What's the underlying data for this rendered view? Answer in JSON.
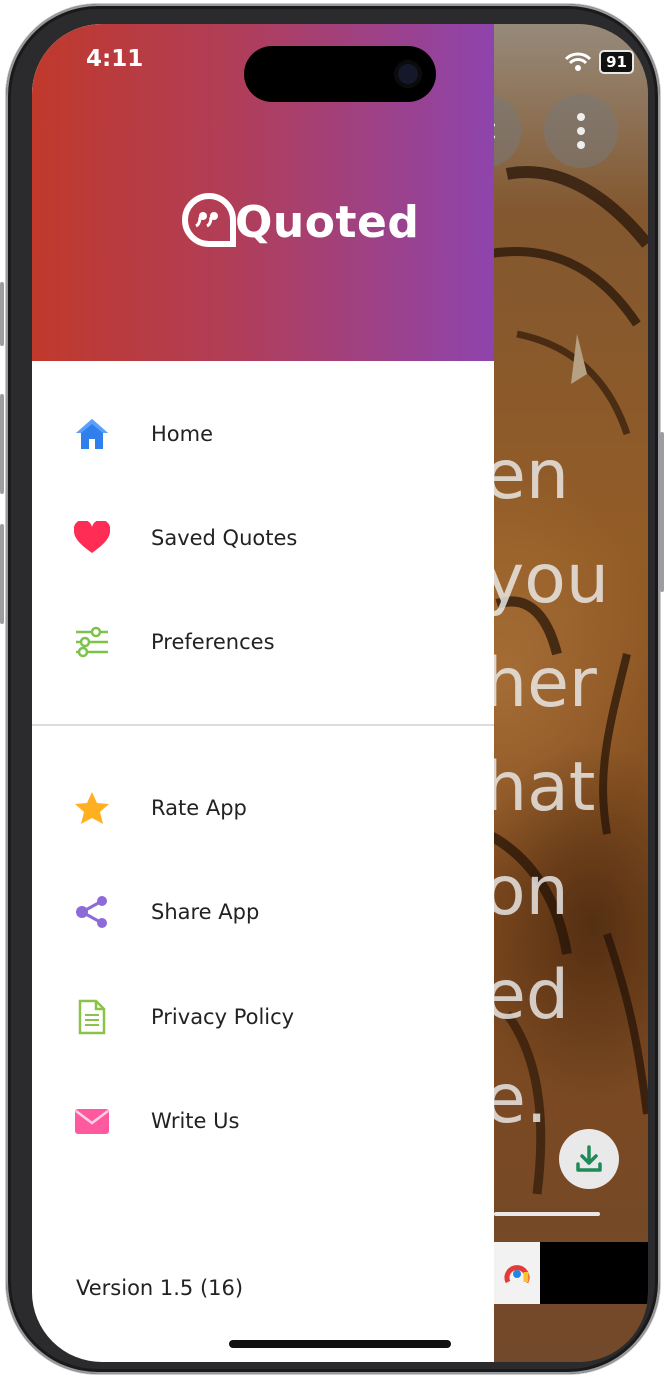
{
  "status_bar": {
    "time": "4:11",
    "battery": "91"
  },
  "app": {
    "name": "Quoted"
  },
  "menu": {
    "primary": [
      {
        "label": "Home",
        "icon": "home-icon"
      },
      {
        "label": "Saved Quotes",
        "icon": "heart-icon"
      },
      {
        "label": "Preferences",
        "icon": "sliders-icon"
      }
    ],
    "secondary": [
      {
        "label": "Rate App",
        "icon": "star-icon"
      },
      {
        "label": "Share App",
        "icon": "share-icon"
      },
      {
        "label": "Privacy Policy",
        "icon": "document-icon"
      },
      {
        "label": "Write Us",
        "icon": "mail-icon"
      }
    ]
  },
  "version": "Version 1.5 (16)",
  "background_quote_fragments": [
    "en",
    "you",
    "her",
    "hat",
    "on",
    "ed",
    "e."
  ],
  "colors": {
    "header_start": "#c0392b",
    "header_end": "#8e44ad",
    "home_icon": "#2f80ed",
    "heart_icon": "#ff2d55",
    "sliders_icon": "#7cc24b",
    "star_icon": "#ffb020",
    "share_icon": "#8e6ad8",
    "document_icon": "#8bc34a",
    "mail_icon": "#ff5aa0",
    "download_icon": "#1e8a57"
  }
}
